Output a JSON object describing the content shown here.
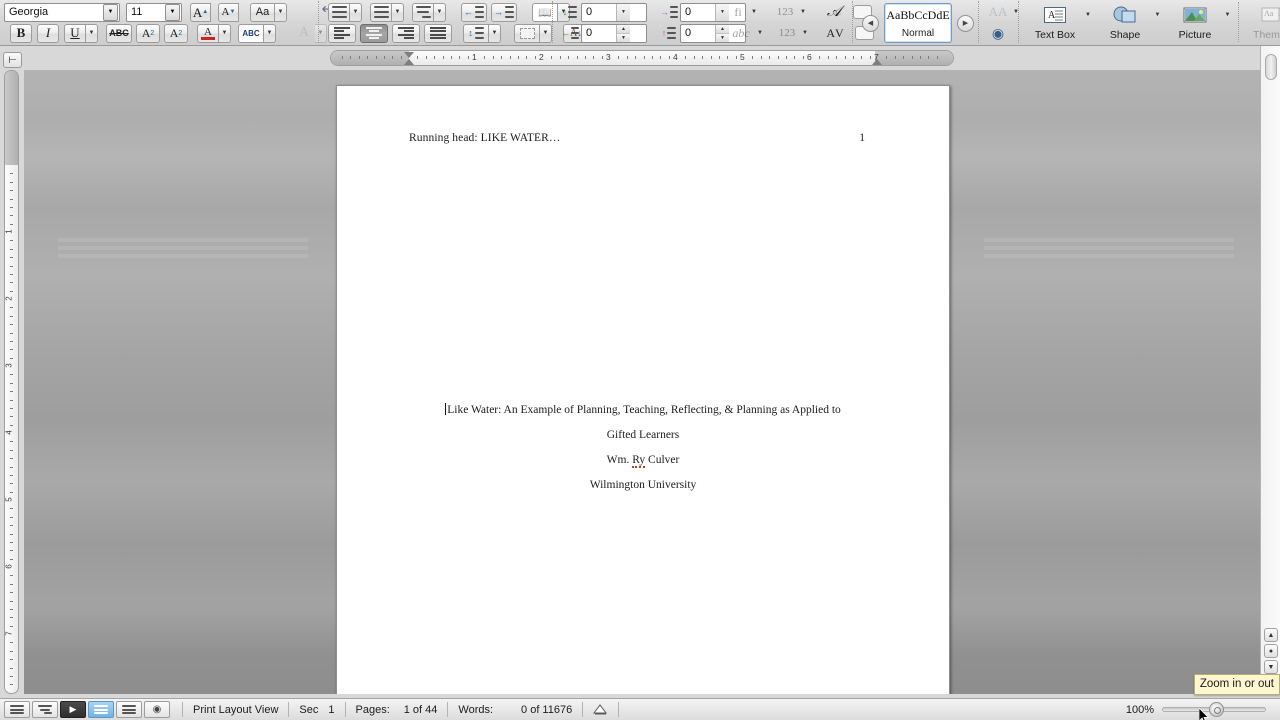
{
  "app": {
    "name": "Microsoft Word"
  },
  "ribbon": {
    "font_group": {
      "font_name": "Georgia",
      "font_size": "11",
      "grow_font": "A",
      "shrink_font": "A",
      "change_case": "Aa",
      "clear_formatting_icon": "clear-formatting-icon",
      "bold": "B",
      "italic": "I",
      "underline": "U",
      "strikethrough": "ABC",
      "superscript": "A2",
      "subscript": "A2",
      "font_color": "A",
      "highlight": "ABC",
      "text_effects": "A"
    },
    "paragraph_group": {
      "bullets": "bullets-icon",
      "numbering": "numbering-icon",
      "multilevel": "multilevel-list-icon",
      "decrease_indent": "decrease-indent-icon",
      "increase_indent": "increase-indent-icon",
      "borders": "borders-icon",
      "align_left": "align-left",
      "align_center": "align-center",
      "align_right": "align-right",
      "align_justify": "align-justify",
      "line_spacing": "line-spacing-icon",
      "shading": "shading-icon",
      "sort": "sort-icon",
      "selected_alignment": "align-center",
      "spacing_before": "0",
      "spacing_after": "0",
      "indent_left": "0",
      "indent_right": "0"
    },
    "styles_group": {
      "preview_sample": "AaBbCcDdE",
      "style_name": "Normal",
      "prev": "◀",
      "next": "▶"
    },
    "insert_group": {
      "text_box": "Text Box",
      "shape": "Shape",
      "picture": "Picture",
      "themes": "Themes"
    }
  },
  "ruler": {
    "horizontal_labels": [
      "1",
      "2",
      "3",
      "4",
      "5",
      "6",
      "7"
    ],
    "vertical_labels": [
      "1",
      "2",
      "3",
      "4",
      "5",
      "6",
      "7"
    ]
  },
  "document": {
    "running_head": "Running head: LIKE WATER…",
    "page_number": "1",
    "title_line_1": "Like Water: An Example of Planning, Teaching, Reflecting, & Planning as Applied to",
    "title_line_2": "Gifted Learners",
    "author_prefix": "Wm. ",
    "author_middle": "Ry",
    "author_suffix": " Culver",
    "institution": "Wilmington University"
  },
  "statusbar": {
    "view_buttons": [
      "draft-view-button",
      "outline-view-button",
      "publishing-layout-view-button",
      "print-layout-view-button",
      "notebook-layout-view-button",
      "full-screen-view-button"
    ],
    "view_name": "Print Layout View",
    "section_label": "Sec",
    "section_value": "1",
    "pages_label": "Pages:",
    "pages_value": "1 of 44",
    "words_label": "Words:",
    "words_value": "0 of 11676",
    "spelling_icon": "spelling-and-grammar-icon",
    "zoom_percent": "100%",
    "tooltip": "Zoom in or out"
  }
}
